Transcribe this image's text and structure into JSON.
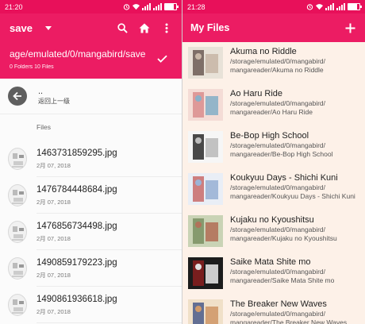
{
  "left": {
    "status": {
      "time": "21:20"
    },
    "toolbar": {
      "title": "save",
      "icons": [
        "search-icon",
        "home-icon",
        "more-vert-icon"
      ]
    },
    "path": {
      "text": "age/emulated/0/mangabird/save",
      "summary": "0 Folders 10 Files"
    },
    "up": {
      "dots": "..",
      "label": "返回上一级"
    },
    "section": "Files",
    "files": [
      {
        "name": "1463731859295.jpg",
        "date": "2月 07, 2018"
      },
      {
        "name": "1476784448684.jpg",
        "date": "2月 07, 2018"
      },
      {
        "name": "1476856734498.jpg",
        "date": "2月 07, 2018"
      },
      {
        "name": "1490859179223.jpg",
        "date": "2月 07, 2018"
      },
      {
        "name": "1490861936618.jpg",
        "date": "2月 07, 2018"
      }
    ]
  },
  "right": {
    "status": {
      "time": "21:28"
    },
    "toolbar": {
      "title": "My Files",
      "icons": [
        "add-icon"
      ]
    },
    "items": [
      {
        "title": "Akuma no Riddle",
        "path1": "/storage/emulated/0/mangabird/",
        "path2": "mangareader/Akuma no Riddle"
      },
      {
        "title": "Ao Haru Ride",
        "path1": "/storage/emulated/0/mangabird/",
        "path2": "mangareader/Ao Haru Ride"
      },
      {
        "title": "Be-Bop High School",
        "path1": "/storage/emulated/0/mangabird/",
        "path2": "mangareader/Be-Bop High School"
      },
      {
        "title": "Koukyuu Days - Shichi Kuni",
        "path1": "/storage/emulated/0/mangabird/",
        "path2": "mangareader/Koukyuu Days - Shichi Kuni"
      },
      {
        "title": "Kujaku no Kyoushitsu",
        "path1": "/storage/emulated/0/mangabird/",
        "path2": "mangareader/Kujaku no Kyoushitsu"
      },
      {
        "title": "Saike Mata Shite mo",
        "path1": "/storage/emulated/0/mangabird/",
        "path2": "mangareader/Saike Mata Shite mo"
      },
      {
        "title": "The Breaker New Waves",
        "path1": "/storage/emulated/0/mangabird/",
        "path2": "mangareader/The Breaker New Waves"
      }
    ]
  },
  "colors": {
    "accent": "#ec1c63",
    "status_bar": "#e8105a",
    "right_background": "#fdf1e8",
    "back_button": "#5f5f5f"
  }
}
